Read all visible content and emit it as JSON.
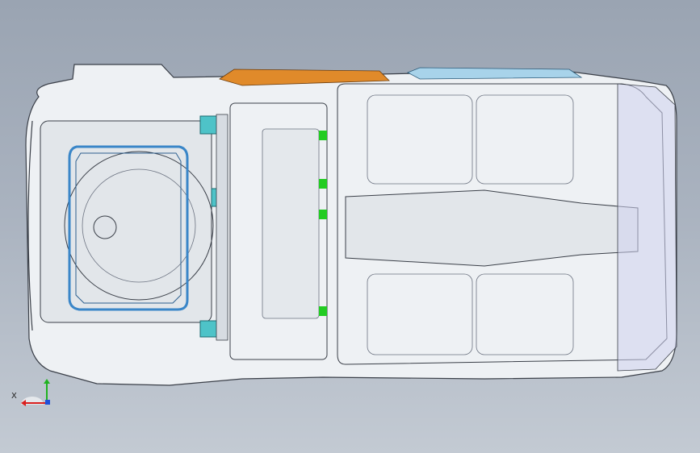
{
  "viewport": {
    "background_top": "#9aa4b2",
    "background_bottom": "#c3cad3"
  },
  "model": {
    "icon": "car-body-floor-assembly",
    "colors": {
      "panel_fill": "#eef1f4",
      "panel_edge": "#3a3f48",
      "inner_fill": "#e2e6ea",
      "shadow": "#c8ced6",
      "blue_wire": "#3a86c8",
      "cyan_bracket": "#4ec3c8",
      "green_clip": "#22cc22",
      "orange_part": "#e08a2a",
      "purple_tint": "#cfd2ee"
    }
  },
  "triad": {
    "icon": "coordinate-triad-icon",
    "x_label": "X",
    "colors": {
      "x": "#d91f1f",
      "y": "#1fb21f",
      "z": "#1f4fd9"
    }
  }
}
